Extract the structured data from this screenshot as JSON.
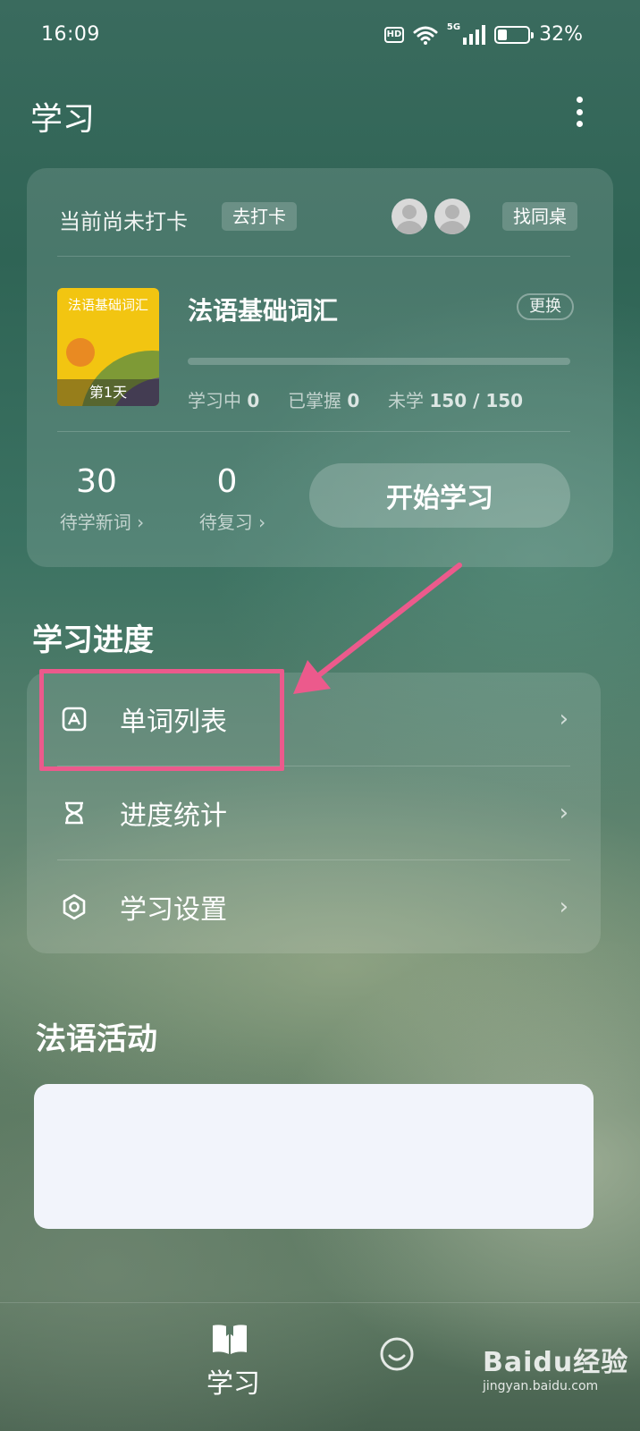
{
  "status_bar": {
    "time": "16:09",
    "hd_badge": "HD",
    "network": "5G",
    "battery_percent": "32%",
    "battery_level": 0.32
  },
  "header": {
    "title": "学习"
  },
  "checkin": {
    "status_text": "当前尚未打卡",
    "checkin_label": "去打卡",
    "find_deskmate_label": "找同桌"
  },
  "book": {
    "cover_title": "法语基础词汇",
    "cover_day": "第1天",
    "name": "法语基础词汇",
    "change_label": "更换",
    "progress_fraction": 0,
    "learning_label": "学习中",
    "learning_value": "0",
    "mastered_label": "已掌握",
    "mastered_value": "0",
    "unlearned_label": "未学",
    "unlearned_value": "150 / 150"
  },
  "summary": {
    "new_words_count": "30",
    "new_words_label": "待学新词 ›",
    "review_count": "0",
    "review_label": "待复习 ›",
    "start_label": "开始学习"
  },
  "progress_section": {
    "title": "学习进度",
    "items": [
      {
        "label": "单词列表",
        "icon": "word-list-icon"
      },
      {
        "label": "进度统计",
        "icon": "hourglass-icon"
      },
      {
        "label": "学习设置",
        "icon": "settings-hex-icon"
      }
    ],
    "chevron": "›"
  },
  "activity_section": {
    "title": "法语活动"
  },
  "bottom_nav": {
    "learn_label": "学习",
    "learn_icon": "book-icon",
    "second_icon": "smile-icon"
  },
  "watermark": {
    "logo": "Baidu经验",
    "url": "jingyan.baidu.com"
  },
  "colors": {
    "highlight": "#ec5a8c",
    "cover_bg": "#f2c511",
    "activity_card": "#f2f4fb"
  }
}
